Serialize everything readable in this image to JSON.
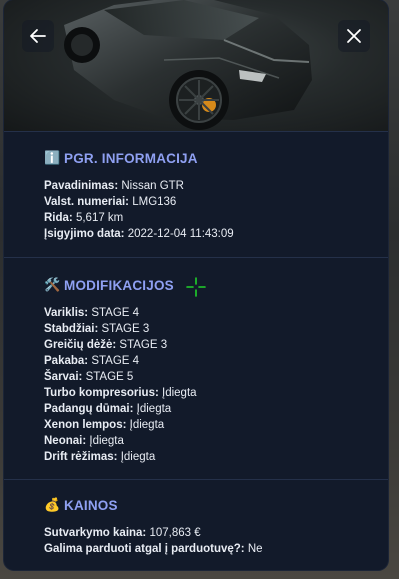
{
  "header": {
    "back_icon": "arrow-left-icon",
    "close_icon": "close-icon"
  },
  "info": {
    "icon": "ℹ️",
    "title": "PGR. INFORMACIJA",
    "rows": [
      {
        "key": "Pavadinimas:",
        "value": "Nissan GTR"
      },
      {
        "key": "Valst. numeriai:",
        "value": "LMG136"
      },
      {
        "key": "Rida:",
        "value": "5,617 km"
      },
      {
        "key": "Įsigyjimo data:",
        "value": "2022-12-04 11:43:09"
      }
    ]
  },
  "mods": {
    "icon": "🛠️",
    "title": "MODIFIKACIJOS",
    "rows": [
      {
        "key": "Variklis:",
        "value": "STAGE 4"
      },
      {
        "key": "Stabdžiai:",
        "value": "STAGE 3"
      },
      {
        "key": "Greičių dėžė:",
        "value": "STAGE 3"
      },
      {
        "key": "Pakaba:",
        "value": "STAGE 4"
      },
      {
        "key": "Šarvai:",
        "value": "STAGE 5"
      },
      {
        "key": "Turbo kompresorius:",
        "value": "Įdiegta"
      },
      {
        "key": "Padangų dūmai:",
        "value": "Įdiegta"
      },
      {
        "key": "Xenon lempos:",
        "value": "Įdiegta"
      },
      {
        "key": "Neonai:",
        "value": "Įdiegta"
      },
      {
        "key": "Drift rėžimas:",
        "value": "Įdiegta"
      }
    ]
  },
  "prices": {
    "icon": "💰",
    "title": "KAINOS",
    "rows": [
      {
        "key": "Sutvarkymo kaina:",
        "value": "107,863 €"
      },
      {
        "key": "Galima parduoti atgal į parduotuvę?:",
        "value": "Ne"
      }
    ]
  },
  "colors": {
    "panel_bg": "#121a2a",
    "title_accent": "#8fa0f2",
    "divider": "#243049",
    "crosshair": "#1fd12a"
  }
}
